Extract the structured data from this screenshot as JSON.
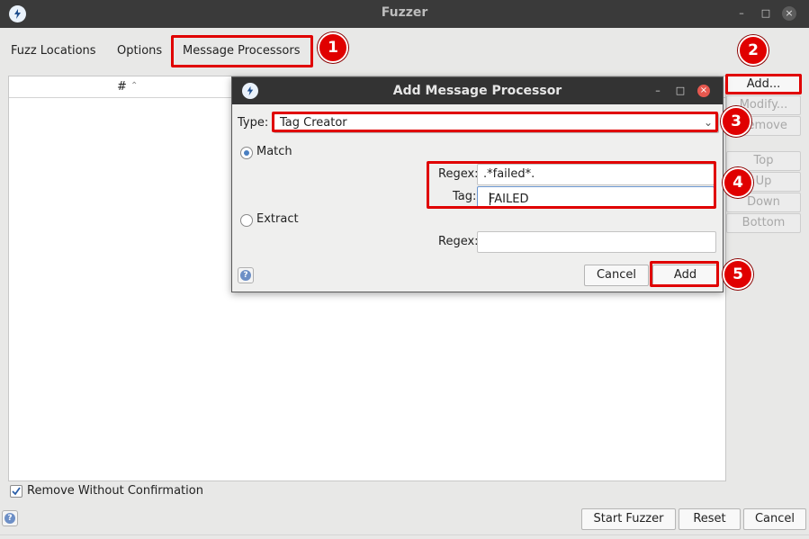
{
  "window": {
    "title": "Fuzzer",
    "minimize_glyph": "–",
    "maximize_glyph": "□",
    "close_glyph": "×",
    "icon": "zap-logo-icon"
  },
  "tabs": [
    {
      "label": "Fuzz Locations"
    },
    {
      "label": "Options"
    },
    {
      "label": "Message Processors"
    }
  ],
  "table": {
    "columns": [
      "#"
    ],
    "sort_indicator": "^"
  },
  "side_buttons": [
    {
      "label": "Add..."
    },
    {
      "label": "Modify..."
    },
    {
      "label": "Remove"
    },
    {
      "label": "Top"
    },
    {
      "label": "Up"
    },
    {
      "label": "Down"
    },
    {
      "label": "Bottom"
    }
  ],
  "remove_without_confirmation": {
    "label": "Remove Without Confirmation",
    "checked": true
  },
  "bottom_buttons": {
    "start": "Start Fuzzer",
    "reset": "Reset",
    "cancel": "Cancel"
  },
  "help_glyph": "?",
  "dialog": {
    "title": "Add Message Processor",
    "type_label": "Type:",
    "type_value": "Tag Creator",
    "match": {
      "label": "Match",
      "selected": true,
      "regex_label": "Regex:",
      "regex_value": ".*failed*.",
      "tag_label": "Tag:",
      "tag_value": "FAILED"
    },
    "extract": {
      "label": "Extract",
      "selected": false,
      "regex_label": "Regex:",
      "regex_value": ""
    },
    "cancel_label": "Cancel",
    "add_label": "Add"
  },
  "annotations": {
    "color": "#e00000",
    "badges": [
      "1",
      "2",
      "3",
      "4",
      "5"
    ]
  }
}
